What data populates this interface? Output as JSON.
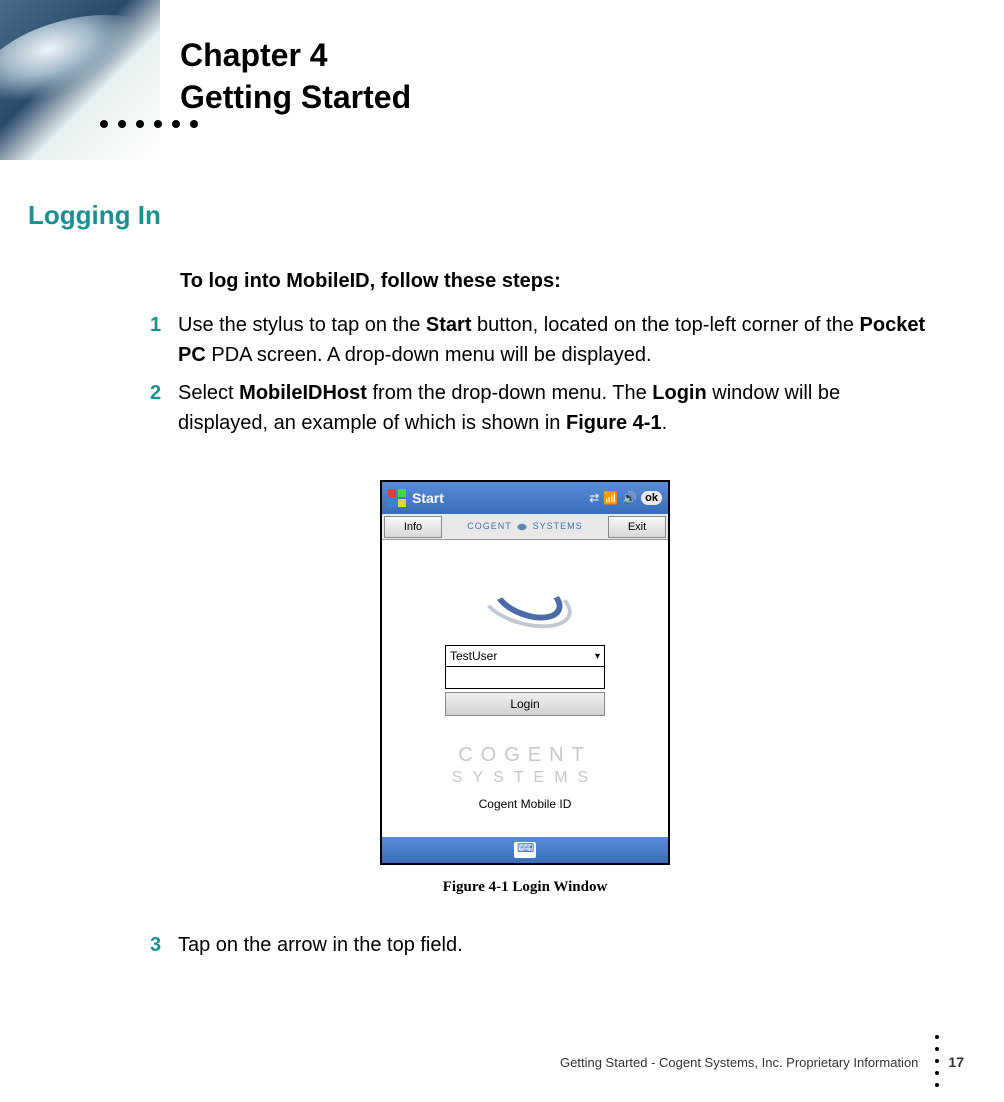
{
  "chapter": {
    "number": "Chapter 4",
    "title": "Getting Started"
  },
  "section_heading": "Logging In",
  "intro": {
    "prefix": "To log into ",
    "product": "MobileID",
    "suffix": ", follow these steps:"
  },
  "steps": [
    {
      "num": "1",
      "parts": [
        {
          "t": "Use the stylus to tap on the ",
          "b": false
        },
        {
          "t": "Start",
          "b": true
        },
        {
          "t": " button, located on the top-left corner of the ",
          "b": false
        },
        {
          "t": "Pocket PC",
          "b": true
        },
        {
          "t": " PDA screen. A drop-down menu will be displayed.",
          "b": false
        }
      ]
    },
    {
      "num": "2",
      "parts": [
        {
          "t": "Select ",
          "b": false
        },
        {
          "t": "MobileIDHost",
          "b": true
        },
        {
          "t": " from the drop-down menu. The ",
          "b": false
        },
        {
          "t": "Login",
          "b": true
        },
        {
          "t": " window will be displayed, an example of which is shown in ",
          "b": false
        },
        {
          "t": "Figure 4-1",
          "b": true
        },
        {
          "t": ".",
          "b": false
        }
      ]
    },
    {
      "num": "3",
      "parts": [
        {
          "t": "Tap on the arrow in the top field.",
          "b": false
        }
      ]
    }
  ],
  "figure": {
    "title_bar": {
      "start": "Start",
      "ok": "ok"
    },
    "toolbar": {
      "info": "Info",
      "brand_left": "COGENT",
      "brand_right": "SYSTEMS",
      "exit": "Exit"
    },
    "login": {
      "user": "TestUser",
      "login_btn": "Login"
    },
    "bg_brand": {
      "line1": "COGENT",
      "line2": "SYSTEMS"
    },
    "app_name": "Cogent Mobile ID",
    "caption": "Figure 4-1 Login Window"
  },
  "footer": {
    "text": "Getting Started  - Cogent Systems, Inc. Proprietary Information",
    "page": "17"
  }
}
